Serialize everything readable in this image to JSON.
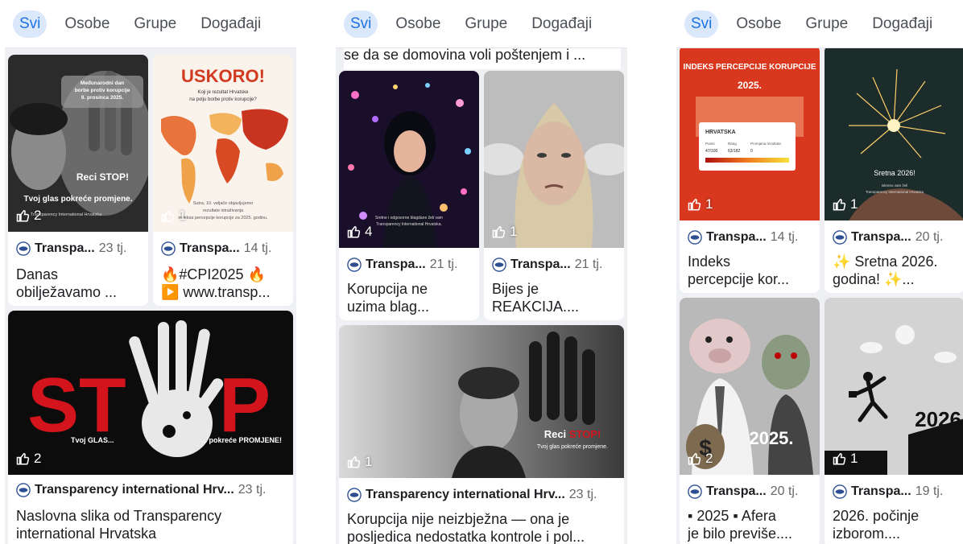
{
  "tabs": [
    "Svi",
    "Osobe",
    "Grupe",
    "Događaji"
  ],
  "panel1": {
    "c1": {
      "title_lines": [
        "Međunarodni dan",
        "borbe protiv korupcije",
        "9. prosinca 2025."
      ],
      "overlay_main": "Reci STOP!",
      "overlay_sub": "Tvoj glas pokreće promjene.",
      "footer": "Transparency International Hrvatska",
      "likes": "2",
      "author": "Transpa...",
      "time": "23 tj.",
      "desc_lines": [
        "Danas",
        "obilježavamo ..."
      ]
    },
    "c2": {
      "headline": "USKORO!",
      "sub_lines": [
        "Koji je rezultat Hrvatske",
        "na polju borbe protiv korupcije?"
      ],
      "bottom_lines": [
        "Sutra, 10. veljače objavljujemo",
        "rezultate istraživanja",
        "indeksa percepcije korupcije za 2025. godinu."
      ],
      "likes": "1",
      "author": "Transpa...",
      "time": "14 tj.",
      "desc_lines": [
        "🔥#CPI2025 🔥",
        "▶️ www.transp..."
      ]
    },
    "c3": {
      "stop_left": "ST",
      "stop_right": "P",
      "glas": "Tvoj GLAS...",
      "pokrece": "... pokreće PROMJENE!",
      "likes": "2",
      "author": "Transparency international Hrv...",
      "time": "23 tj.",
      "desc_lines": [
        "Naslovna slika od Transparency",
        "international Hrvatska"
      ]
    }
  },
  "panel2": {
    "top_text": "se da se domovina voli poštenjem i ...",
    "c1": {
      "caption_lines": [
        "Sretne i odgovorne blagdane želi vam",
        "Transparency International Hrvatska."
      ],
      "likes": "4",
      "author": "Transpa...",
      "time": "21 tj.",
      "desc_lines": [
        "Korupcija ne",
        "uzima blag..."
      ]
    },
    "c2": {
      "likes": "1",
      "author": "Transpa...",
      "time": "21 tj.",
      "desc_lines": [
        "Bijes je",
        "REAKCIJA...."
      ]
    },
    "c3": {
      "overlay_main_a": "Reci ",
      "overlay_main_b": "STOP!",
      "overlay_sub": "Tvoj glas pokreće promjene.",
      "likes": "1",
      "author": "Transparency international Hrv...",
      "time": "23 tj.",
      "desc_lines": [
        "Korupcija nije neizbježna — ona je",
        "posljedica nedostatka kontrole i pol..."
      ]
    }
  },
  "panel3": {
    "c1": {
      "title_lines": [
        "INDEKS PERCEPCIJE KORUPCIJE",
        "2025."
      ],
      "country": "HRVATSKA",
      "col_labels": [
        "Poeni",
        "Rang",
        "Promjena rezultata"
      ],
      "col_values": [
        "47/100",
        "63/182",
        "0"
      ],
      "likes": "1",
      "author": "Transpa...",
      "time": "14 tj.",
      "desc_lines": [
        "Indeks",
        "percepcije kor..."
      ]
    },
    "c2": {
      "greeting": "Sretna 2026!",
      "caption_lines": [
        "Iskreno vam želi",
        "Transparency International Hrvatska"
      ],
      "likes": "1",
      "author": "Transpa...",
      "time": "20 tj.",
      "desc_lines": [
        "✨ Sretna 2026.",
        "godina! ✨..."
      ]
    },
    "c3": {
      "year": "2025.",
      "likes": "2",
      "author": "Transpa...",
      "time": "20 tj.",
      "desc_lines": [
        "▪ 2025 ▪ Afera",
        "je bilo previše...."
      ]
    },
    "c4": {
      "year": "2026",
      "likes": "1",
      "author": "Transpa...",
      "time": "19 tj.",
      "desc_lines": [
        "2026. počinje",
        "izborom...."
      ]
    }
  },
  "colors": {
    "accent": "#1b74e4",
    "tab_active_bg": "#dbe7fb",
    "stop_red": "#d4141c"
  }
}
